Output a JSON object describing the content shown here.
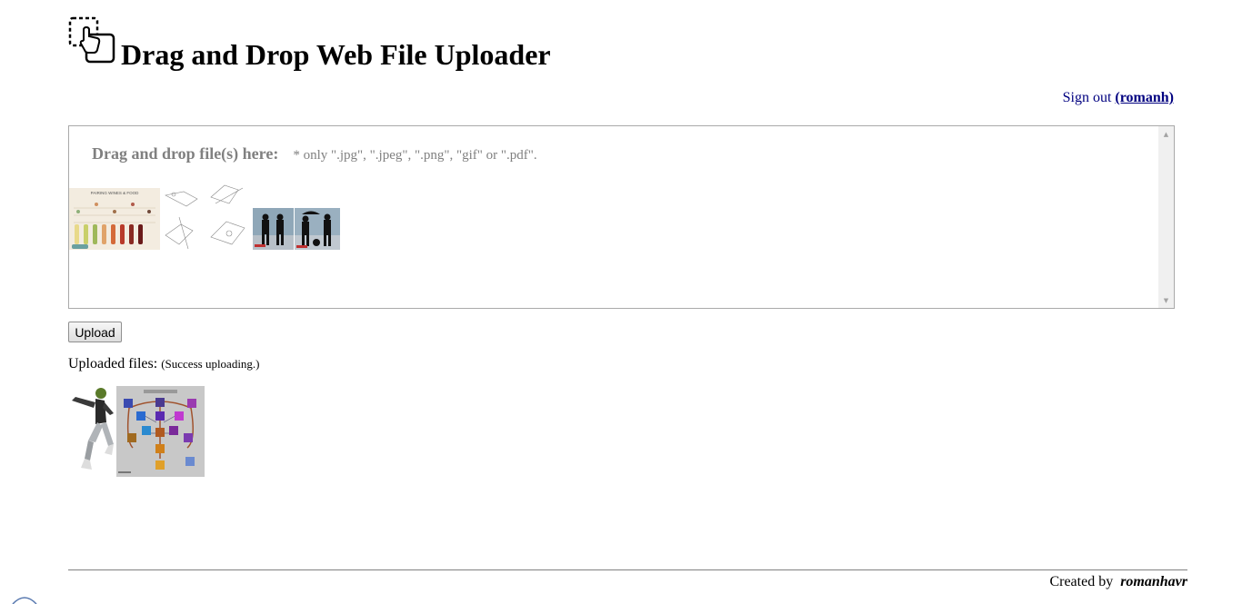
{
  "header": {
    "logo_icon": "drag-drop-icon",
    "title": "Drag and Drop Web File Uploader"
  },
  "account": {
    "signout_text": "Sign out",
    "username": "(romanh)"
  },
  "dropzone": {
    "label": "Drag and drop file(s) here:",
    "note": "* only \".jpg\", \".jpeg\", \".png\", \"gif\" or \".pdf\".",
    "thumbnails": [
      {
        "name": "pairing-wines-food",
        "caption": "PAIRING WINES & FOOD"
      },
      {
        "name": "mechanical-drawing"
      },
      {
        "name": "mechanical-drawing-2"
      },
      {
        "name": "people-photo-1"
      },
      {
        "name": "people-photo-2"
      }
    ]
  },
  "upload": {
    "button_label": "Upload"
  },
  "uploaded": {
    "label": "Uploaded files:",
    "status": "(Success uploading.)",
    "files": [
      {
        "name": "dancer-image"
      },
      {
        "name": "skill-tree-image"
      }
    ]
  },
  "footer": {
    "created_by": "Created by",
    "author": "romanhavr"
  },
  "colors": {
    "signout_link": "#000080",
    "dropzone_text": "#808080",
    "dropzone_border": "#a9a9a9",
    "scrollbar_track": "#f0f0f0"
  }
}
